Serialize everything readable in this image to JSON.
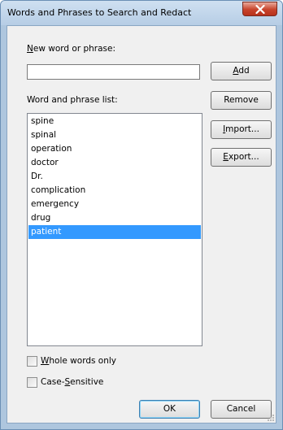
{
  "window": {
    "title": "Words and Phrases to Search and Redact",
    "close_icon": "close-x"
  },
  "new_word": {
    "label_prefix": "N",
    "label_rest": "ew word or phrase:",
    "value": "",
    "placeholder": ""
  },
  "list": {
    "label": "Word and phrase list:",
    "items": [
      "spine",
      "spinal",
      "operation",
      "doctor",
      "Dr.",
      "complication",
      "emergency",
      "drug",
      "patient"
    ],
    "selected_index": 8
  },
  "buttons": {
    "add_prefix": "A",
    "add_rest": "dd",
    "remove": "Remove",
    "import_prefix": "I",
    "import_rest": "mport...",
    "export_prefix": "E",
    "export_rest": "xport...",
    "ok": "OK",
    "cancel": "Cancel"
  },
  "options": {
    "whole_words_prefix": "W",
    "whole_words_rest": "hole words only",
    "whole_words_checked": false,
    "case_sensitive_prefix": "Case-",
    "case_sensitive_accel": "S",
    "case_sensitive_rest": "ensitive",
    "case_sensitive_checked": false
  },
  "colors": {
    "selection": "#3399ff",
    "frame": "#aec6de",
    "close_button": "#c7432b"
  }
}
